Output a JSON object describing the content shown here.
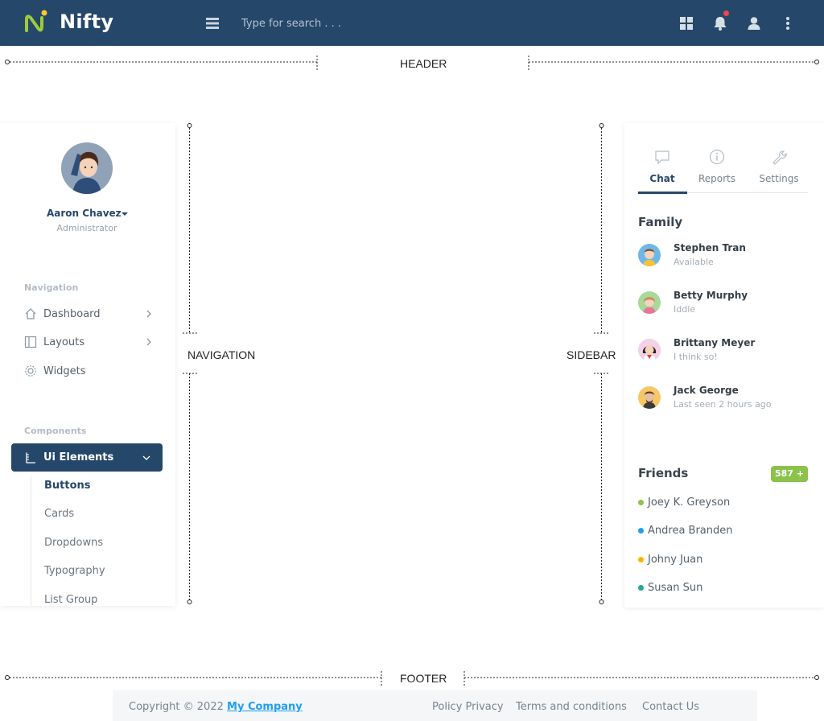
{
  "header": {
    "brand": "Nifty",
    "search_placeholder": "Type for search . . .",
    "icons": [
      "menu-icon",
      "apps-grid-icon",
      "bell-icon",
      "user-icon",
      "more-vertical-icon"
    ],
    "notification_dot_color": "#f5424c",
    "background": "#25476a"
  },
  "regions": {
    "header": "HEADER",
    "navigation": "NAVIGATION",
    "sidebar": "SIDEBAR",
    "footer": "FOOTER"
  },
  "profile": {
    "name": "Aaron Chavez",
    "role": "Administrator"
  },
  "nav": {
    "heading": "Navigation",
    "items": [
      {
        "label": "Dashboard",
        "icon": "home-icon"
      },
      {
        "label": "Layouts",
        "icon": "layout-icon"
      },
      {
        "label": "Widgets",
        "icon": "gear-icon"
      }
    ],
    "components_heading": "Components",
    "active_item": "Ui Elements",
    "sub_items": [
      "Buttons",
      "Cards",
      "Dropdowns",
      "Typography",
      "List Group"
    ]
  },
  "sidebar": {
    "tabs": [
      {
        "label": "Chat",
        "icon": "chat-icon"
      },
      {
        "label": "Reports",
        "icon": "info-icon"
      },
      {
        "label": "Settings",
        "icon": "wrench-icon"
      }
    ],
    "family_title": "Family",
    "family": [
      {
        "name": "Stephen Tran",
        "status": "Available"
      },
      {
        "name": "Betty Murphy",
        "status": "Iddle"
      },
      {
        "name": "Brittany Meyer",
        "status": "I think so!"
      },
      {
        "name": "Jack George",
        "status": "Last seen 2 hours ago"
      }
    ],
    "friends_title": "Friends",
    "friends_badge": "587 +",
    "friends": [
      {
        "name": "Joey K. Greyson",
        "color": "#8bc34a"
      },
      {
        "name": "Andrea Branden",
        "color": "#1e9ff2"
      },
      {
        "name": "Johny Juan",
        "color": "#ffb300"
      },
      {
        "name": "Susan Sun",
        "color": "#26a69a"
      }
    ]
  },
  "footer": {
    "copyright": "Copyright © 2022",
    "company": "My Company",
    "links": [
      "Policy Privacy",
      "Terms and conditions",
      "Contact Us"
    ]
  }
}
